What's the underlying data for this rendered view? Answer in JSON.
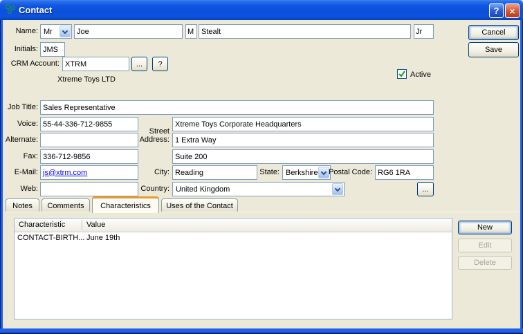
{
  "window": {
    "title": "Contact"
  },
  "titlebar": {
    "help_glyph": "?",
    "close_glyph": "×"
  },
  "actions": {
    "cancel": "Cancel",
    "save": "Save"
  },
  "fields": {
    "name": {
      "label": "Name:",
      "title": "Mr",
      "first": "Joe",
      "middle": "M",
      "last": "Stealt",
      "suffix": "Jr"
    },
    "initials": {
      "label": "Initials:",
      "value": "JMS"
    },
    "crm_account": {
      "label": "CRM Account:",
      "value": "XTRM",
      "browse_label": "...",
      "help_label": "?",
      "resolved_name": "Xtreme Toys LTD"
    },
    "active": {
      "label": "Active",
      "checked": true
    },
    "job_title": {
      "label": "Job Title:",
      "value": "Sales Representative"
    },
    "voice": {
      "label": "Voice:",
      "value": "55-44-336-712-9855"
    },
    "alternate": {
      "label": "Alternate:",
      "value": ""
    },
    "fax": {
      "label": "Fax:",
      "value": "336-712-9856"
    },
    "email": {
      "label": "E-Mail:",
      "value": "js@xtrm.com"
    },
    "web": {
      "label": "Web:",
      "value": ""
    },
    "street": {
      "label_line1": "Street",
      "label_line2": "Address:",
      "line1": "Xtreme Toys Corporate Headquarters",
      "line2": "1 Extra Way",
      "line3": "Suite 200"
    },
    "city": {
      "label": "City:",
      "value": "Reading"
    },
    "state": {
      "label": "State:",
      "value": "Berkshire"
    },
    "postal_code": {
      "label": "Postal Code:",
      "value": "RG6 1RA"
    },
    "country": {
      "label": "Country:",
      "value": "United Kingdom",
      "browse_label": "..."
    }
  },
  "tabs": [
    {
      "label": "Notes"
    },
    {
      "label": "Comments"
    },
    {
      "label": "Characteristics"
    },
    {
      "label": "Uses of the Contact"
    }
  ],
  "table": {
    "columns": [
      "Characteristic",
      "Value"
    ],
    "rows": [
      [
        "CONTACT-BIRTH...",
        "June 19th"
      ]
    ]
  },
  "table_actions": {
    "new": "New",
    "edit": "Edit",
    "delete": "Delete"
  }
}
